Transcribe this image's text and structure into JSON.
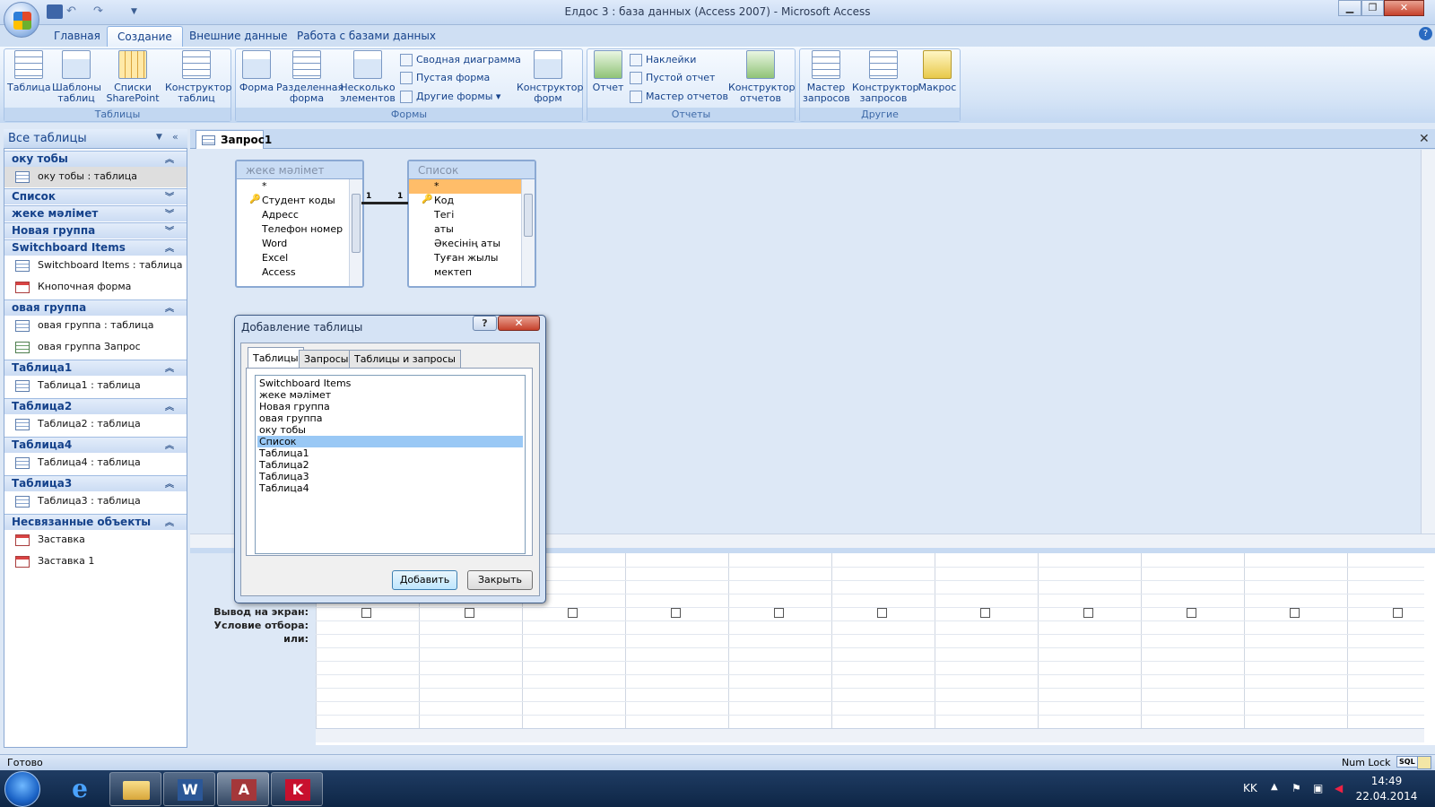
{
  "window": {
    "title": "Елдос 3 : база данных (Access 2007) - Microsoft Access"
  },
  "ribbon_tabs": [
    "Главная",
    "Создание",
    "Внешние данные",
    "Работа с базами данных"
  ],
  "ribbon": {
    "tables": {
      "label": "Таблицы",
      "buttons": [
        "Таблица",
        "Шаблоны таблиц",
        "Списки SharePoint",
        "Конструктор таблиц"
      ]
    },
    "forms": {
      "label": "Формы",
      "buttons": [
        "Форма",
        "Разделенная форма",
        "Несколько элементов",
        "Конструктор форм"
      ],
      "small": [
        "Сводная диаграмма",
        "Пустая форма",
        "Другие формы"
      ]
    },
    "reports": {
      "label": "Отчеты",
      "buttons": [
        "Отчет",
        "Конструктор отчетов"
      ],
      "small": [
        "Наклейки",
        "Пустой отчет",
        "Мастер отчетов"
      ]
    },
    "other": {
      "label": "Другие",
      "buttons": [
        "Мастер запросов",
        "Конструктор запросов",
        "Макрос"
      ]
    }
  },
  "nav": {
    "header": "Все таблицы",
    "groups": [
      {
        "name": "оку тобы",
        "items": [
          {
            "label": "оку тобы : таблица",
            "type": "table",
            "selected": true
          }
        ]
      },
      {
        "name": "Список",
        "items": []
      },
      {
        "name": "жеке мәлімет",
        "items": []
      },
      {
        "name": "Новая группа",
        "items": []
      },
      {
        "name": "Switchboard Items",
        "items": [
          {
            "label": "Switchboard Items : таблица",
            "type": "table"
          },
          {
            "label": "Кнопочная форма",
            "type": "form"
          }
        ]
      },
      {
        "name": "овая группа",
        "items": [
          {
            "label": "овая группа : таблица",
            "type": "table"
          },
          {
            "label": "овая группа Запрос",
            "type": "query"
          }
        ]
      },
      {
        "name": "Таблица1",
        "items": [
          {
            "label": "Таблица1 : таблица",
            "type": "table"
          }
        ]
      },
      {
        "name": "Таблица2",
        "items": [
          {
            "label": "Таблица2 : таблица",
            "type": "table"
          }
        ]
      },
      {
        "name": "Таблица4",
        "items": [
          {
            "label": "Таблица4 : таблица",
            "type": "table"
          }
        ]
      },
      {
        "name": "Таблица3",
        "items": [
          {
            "label": "Таблица3 : таблица",
            "type": "table"
          }
        ]
      },
      {
        "name": "Несвязанные объекты",
        "items": [
          {
            "label": "Заставка",
            "type": "form"
          },
          {
            "label": "Заставка 1",
            "type": "form"
          }
        ]
      }
    ]
  },
  "document": {
    "tab": "Запрос1"
  },
  "tables": [
    {
      "title": "жеке мәлімет",
      "fields": [
        "*",
        "Студент коды",
        "Адресс",
        "Телефон номер",
        "Word",
        "Excel",
        "Access"
      ],
      "key_index": 1
    },
    {
      "title": "Список",
      "fields": [
        "*",
        "Код",
        "Тегі",
        "аты",
        "Әкесінің аты",
        "Туған жылы",
        "мектеп"
      ],
      "key_index": 1,
      "highlight_index": 0
    }
  ],
  "relation": {
    "left": "1",
    "right": "1"
  },
  "grid": {
    "rows": [
      "Вывод на экран:",
      "Условие отбора:",
      "или:"
    ]
  },
  "dialog": {
    "title": "Добавление таблицы",
    "tabs": [
      "Таблицы",
      "Запросы",
      "Таблицы и запросы"
    ],
    "items": [
      "Switchboard Items",
      "жеке мәлімет",
      "Новая группа",
      "овая группа",
      "оку тобы",
      "Список",
      "Таблица1",
      "Таблица2",
      "Таблица3",
      "Таблица4"
    ],
    "selected": "Список",
    "add": "Добавить",
    "close": "Закрыть",
    "help": "?"
  },
  "status": {
    "left": "Готово",
    "numlock": "Num Lock",
    "sql": "SQL"
  },
  "taskbar": {
    "lang": "KK",
    "time": "14:49",
    "date": "22.04.2014"
  }
}
